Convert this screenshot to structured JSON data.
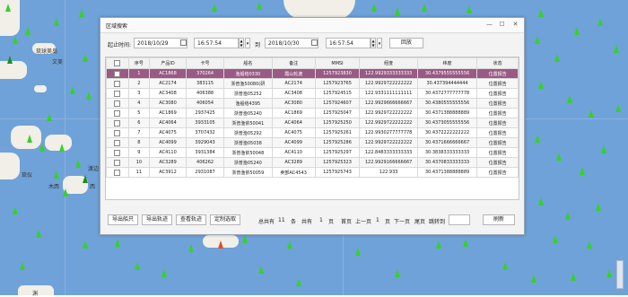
{
  "map": {
    "labels": [
      "琉球美岛",
      "文美",
      "渡边",
      "木西",
      "西",
      "琉仪",
      "渊"
    ]
  },
  "dialog": {
    "title": "区域搜索",
    "minimize": "—",
    "maximize": "☐",
    "close": "✕",
    "search": {
      "start_label": "起止时间:",
      "start_date": "2018/10/29",
      "start_time": "16:57:54",
      "to_label": "到",
      "end_date": "2018/10/30",
      "end_time": "16:57:54",
      "search_button": "回放"
    },
    "table": {
      "headers": [
        "",
        "序号",
        "产品ID",
        "卡号",
        "船名",
        "备注",
        "MMSI",
        "经度",
        "纬度",
        "状态"
      ],
      "rows": [
        [
          "",
          "1",
          "AC1868",
          "370264",
          "渔船结0330",
          "霞山轮渡",
          "1257923830",
          "122.9929333333333",
          "30.4379555555556",
          "位置报告"
        ],
        [
          "",
          "2",
          "AC2174",
          "383115",
          "浙普渔50080(研",
          "AC2174",
          "1257923765",
          "122.9929722222222",
          "30.437394444444",
          "位置报告"
        ],
        [
          "",
          "3",
          "AC3408",
          "406388",
          "浙普渔05252",
          "AC3408",
          "1257924515",
          "122.9331111111111",
          "30.4372777777778",
          "位置报告"
        ],
        [
          "",
          "4",
          "AC3080",
          "406054",
          "渔船结4395",
          "AC3080",
          "1257924607",
          "122.9929666666667",
          "30.4380555555556",
          "位置报告"
        ],
        [
          "",
          "5",
          "AC1869",
          "2937425",
          "浙普渔05240",
          "AC1869",
          "1257925047",
          "122.9929722222222",
          "30.4371388888889",
          "位置报告"
        ],
        [
          "",
          "6",
          "AC4064",
          "3933105",
          "浙普渔依50041",
          "AC4064",
          "1257925250",
          "122.9929722222222",
          "30.4373055555556",
          "位置报告"
        ],
        [
          "",
          "7",
          "AC4075",
          "3707432",
          "浙普渔05292",
          "AC4075",
          "1257925261",
          "122.9930277777778",
          "30.4372222222222",
          "位置报告"
        ],
        [
          "",
          "8",
          "AC4099",
          "3929043",
          "浙普渔05038",
          "AC4099",
          "1257925286",
          "122.9929722222222",
          "30.4371666666667",
          "位置报告"
        ],
        [
          "",
          "9",
          "AC4110",
          "3931384",
          "浙普渔依50048",
          "AC4110",
          "1257925297",
          "122.8483333333333",
          "30.3838333333333",
          "位置报告"
        ],
        [
          "",
          "10",
          "AC3289",
          "406262",
          "浙普渔05240",
          "AC3289",
          "1257925323",
          "122.9929166666667",
          "30.4370833333333",
          "位置报告"
        ],
        [
          "",
          "11",
          "AC3912",
          "2931087",
          "浙普渔依50059",
          "卖部AC4543",
          "1257925743",
          "122.933",
          "30.4371388888889",
          "位置报告"
        ]
      ]
    },
    "footer": {
      "export_points": "导出船只",
      "export_track": "导出轨迹",
      "view_track": "查看轨迹",
      "locate": "定制选取",
      "total_label": "总共有",
      "total": "11",
      "unit": "条",
      "pages_label": "共有",
      "pages": "1",
      "page_unit": "页",
      "first": "首页",
      "prev": "上一页",
      "current_page": "1",
      "page_suffix": "页",
      "next": "下一页",
      "last": "尾页",
      "jump": "跳转到",
      "refresh": "刷新"
    }
  }
}
